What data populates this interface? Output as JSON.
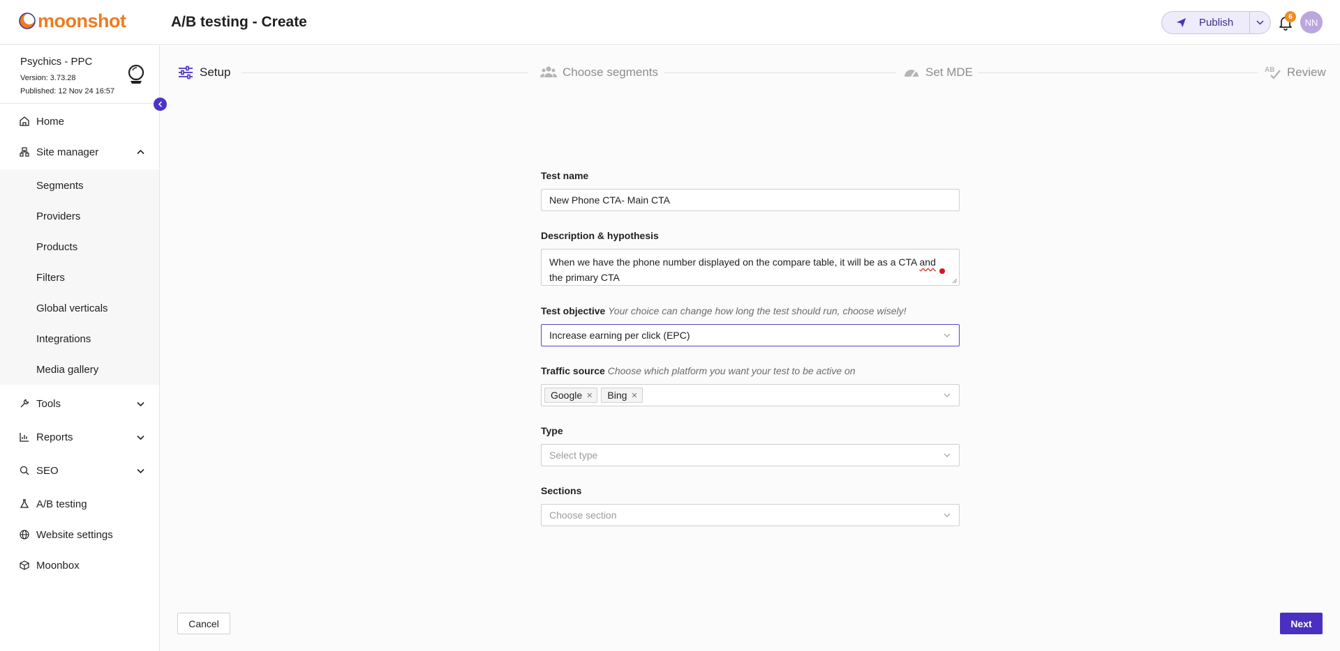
{
  "header": {
    "logo_text": "moonshot",
    "page_title": "A/B testing - Create",
    "publish_label": "Publish",
    "notification_count": "6",
    "avatar_initials": "NN",
    "accent_color": "#4a2fc0"
  },
  "site": {
    "name": "Psychics - PPC",
    "version": "Version: 3.73.28",
    "published": "Published: 12 Nov 24 16:57"
  },
  "sidebar": {
    "home": "Home",
    "site_manager": "Site manager",
    "sub_items": [
      "Segments",
      "Providers",
      "Products",
      "Filters",
      "Global verticals",
      "Integrations",
      "Media gallery"
    ],
    "tools": "Tools",
    "reports": "Reports",
    "seo": "SEO",
    "ab_testing": "A/B testing",
    "website_settings": "Website settings",
    "moonbox": "Moonbox"
  },
  "stepper": {
    "steps": [
      "Setup",
      "Choose segments",
      "Set MDE",
      "Review"
    ],
    "active_index": 0
  },
  "form": {
    "test_name_label": "Test name",
    "test_name_value": "New Phone CTA- Main CTA",
    "description_label": "Description & hypothesis",
    "description_before": "When we have the phone number displayed on the compare table, it will be as a CTA ",
    "description_flagged_word": "and",
    "description_line2": "the primary CTA",
    "objective_label": "Test objective",
    "objective_hint": "Your choice can change how long the test should run, choose wisely!",
    "objective_value": "Increase earning per click (EPC)",
    "traffic_label": "Traffic source",
    "traffic_hint": "Choose which platform you want your test to be active on",
    "traffic_tags": [
      "Google",
      "Bing"
    ],
    "type_label": "Type",
    "type_placeholder": "Select type",
    "sections_label": "Sections",
    "sections_placeholder": "Choose section"
  },
  "footer": {
    "cancel_label": "Cancel",
    "next_label": "Next"
  }
}
